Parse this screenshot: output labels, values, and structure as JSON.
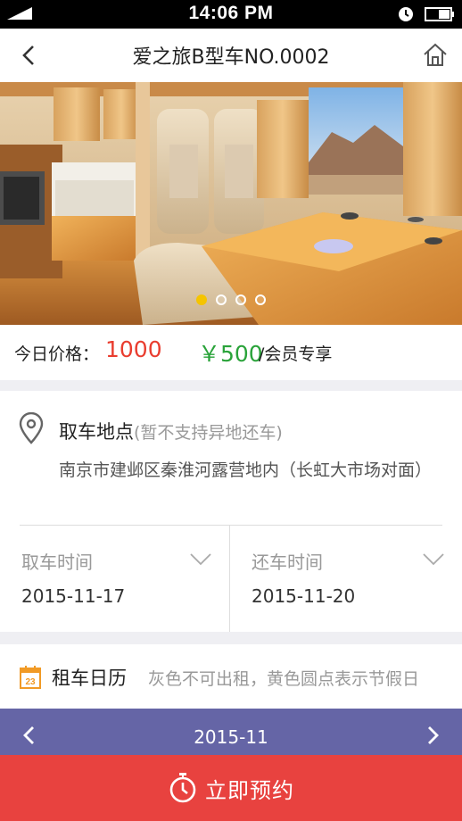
{
  "status_bar": {
    "time": "14:06 PM",
    "icons": [
      "signal-icon",
      "alarm-icon",
      "battery-icon"
    ]
  },
  "nav": {
    "title": "爱之旅B型车NO.0002",
    "back_icon": "chevron-left-icon",
    "home_icon": "home-icon"
  },
  "gallery": {
    "slide_count": 4,
    "active_index": 0
  },
  "price": {
    "label": "今日价格：",
    "today": "1000",
    "member": "￥500",
    "member_note": "/会员专享",
    "today_color": "#e93d2f",
    "member_color": "#2aa33a"
  },
  "pickup": {
    "title": "取车地点",
    "note": "(暂不支持异地还车)",
    "address": "南京市建邺区秦淮河露营地内（长虹大市场对面）"
  },
  "times": {
    "pickup_label": "取车时间",
    "pickup_value": "2015-11-17",
    "return_label": "还车时间",
    "return_value": "2015-11-20"
  },
  "calendar": {
    "icon_day": "23",
    "title": "租车日历",
    "note": "灰色不可出租，黄色圆点表示节假日",
    "month": "2015-11",
    "bar_color": "#6565a6"
  },
  "booking": {
    "label": "立即预约",
    "color": "#e8423f"
  }
}
